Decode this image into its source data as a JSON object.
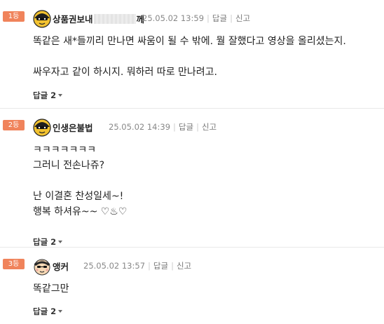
{
  "comments": [
    {
      "rank": "1등",
      "nickname_start": "상품권보내",
      "nickname_end": "께",
      "date": "25.05.02 13:59",
      "reply_label": "답글",
      "report_label": "신고",
      "body": "똑같은 새*들끼리 만나면 싸움이 될 수 밖에. 뭘 잘했다고 영상을 올리셨는지.\n\n싸우자고 같이 하시지. 뭐하러 따로 만나려고.",
      "replies_label": "답글 2"
    },
    {
      "rank": "2등",
      "nickname": "인생은불법",
      "date": "25.05.02 14:39",
      "reply_label": "답글",
      "report_label": "신고",
      "body": "ㅋㅋㅋㅋㅋㅋㅋ\n그러니 전손나쥬?\n\n난 이결혼 찬성일세~!\n행복 하셔유~~ ♡♨♡",
      "replies_label": "답글 2"
    },
    {
      "rank": "3등",
      "nickname": "앵커",
      "date": "25.05.02 13:57",
      "reply_label": "답글",
      "report_label": "신고",
      "body": "똑같그만",
      "replies_label": "답글 2"
    }
  ],
  "colors": {
    "rank_badge": "#f0835b",
    "date_text": "#888888",
    "divider": "#e8e8e8"
  },
  "icons": [
    "avatar-helmet-icon",
    "avatar-helmet-icon",
    "avatar-face-icon",
    "chevron-down-icon"
  ]
}
